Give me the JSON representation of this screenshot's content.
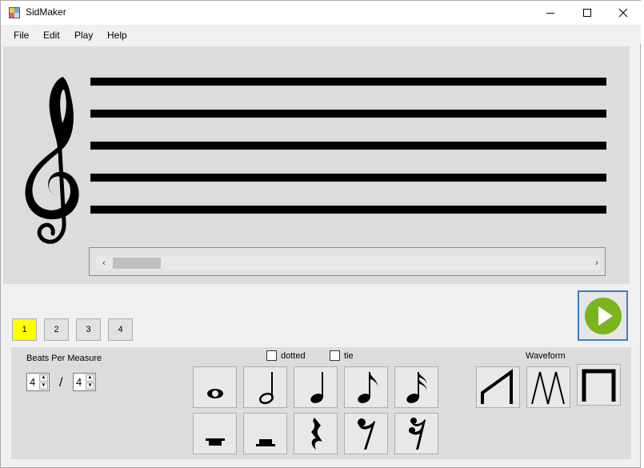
{
  "window": {
    "title": "SidMaker"
  },
  "menu": {
    "items": [
      "File",
      "Edit",
      "Play",
      "Help"
    ]
  },
  "measures": {
    "items": [
      "1",
      "2",
      "3",
      "4"
    ],
    "active_index": 0,
    "active_color": "#ffff00"
  },
  "time_signature": {
    "label": "Beats Per Measure",
    "numerator": "4",
    "denominator": "4",
    "separator": "/"
  },
  "options": {
    "dotted_label": "dotted",
    "tie_label": "tie",
    "dotted_checked": false,
    "tie_checked": false
  },
  "notes": {
    "row1": [
      "whole-note",
      "half-note",
      "quarter-note",
      "eighth-note",
      "sixteenth-note"
    ],
    "row2": [
      "whole-rest",
      "half-rest",
      "quarter-rest",
      "eighth-rest",
      "sixteenth-rest"
    ]
  },
  "waveform": {
    "label": "Waveform",
    "items": [
      "sawtooth",
      "triangle",
      "square"
    ],
    "selected": "square"
  },
  "colors": {
    "play_button": "#7bb51e",
    "play_border": "#3b7fc4",
    "staff_bg": "#dcdcdc"
  }
}
